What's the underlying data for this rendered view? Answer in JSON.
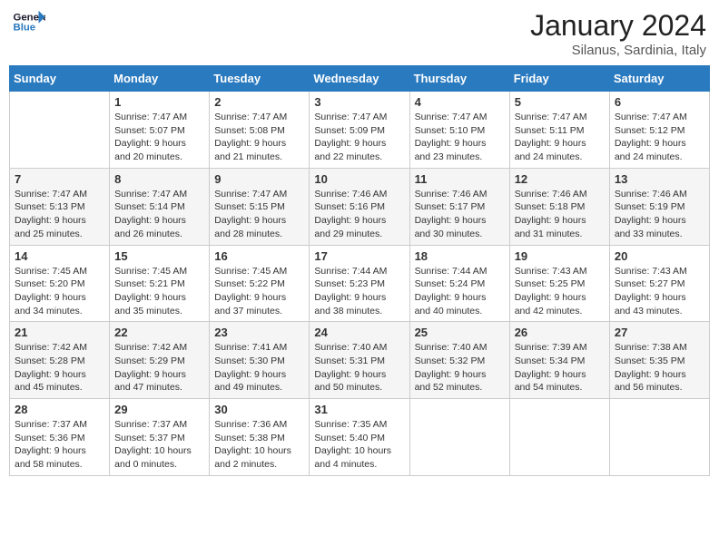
{
  "header": {
    "logo_line1": "General",
    "logo_line2": "Blue",
    "month": "January 2024",
    "location": "Silanus, Sardinia, Italy"
  },
  "weekdays": [
    "Sunday",
    "Monday",
    "Tuesday",
    "Wednesday",
    "Thursday",
    "Friday",
    "Saturday"
  ],
  "weeks": [
    [
      {
        "day": "",
        "sunrise": "",
        "sunset": "",
        "daylight": ""
      },
      {
        "day": "1",
        "sunrise": "Sunrise: 7:47 AM",
        "sunset": "Sunset: 5:07 PM",
        "daylight": "Daylight: 9 hours and 20 minutes."
      },
      {
        "day": "2",
        "sunrise": "Sunrise: 7:47 AM",
        "sunset": "Sunset: 5:08 PM",
        "daylight": "Daylight: 9 hours and 21 minutes."
      },
      {
        "day": "3",
        "sunrise": "Sunrise: 7:47 AM",
        "sunset": "Sunset: 5:09 PM",
        "daylight": "Daylight: 9 hours and 22 minutes."
      },
      {
        "day": "4",
        "sunrise": "Sunrise: 7:47 AM",
        "sunset": "Sunset: 5:10 PM",
        "daylight": "Daylight: 9 hours and 23 minutes."
      },
      {
        "day": "5",
        "sunrise": "Sunrise: 7:47 AM",
        "sunset": "Sunset: 5:11 PM",
        "daylight": "Daylight: 9 hours and 24 minutes."
      },
      {
        "day": "6",
        "sunrise": "Sunrise: 7:47 AM",
        "sunset": "Sunset: 5:12 PM",
        "daylight": "Daylight: 9 hours and 24 minutes."
      }
    ],
    [
      {
        "day": "7",
        "sunrise": "Sunrise: 7:47 AM",
        "sunset": "Sunset: 5:13 PM",
        "daylight": "Daylight: 9 hours and 25 minutes."
      },
      {
        "day": "8",
        "sunrise": "Sunrise: 7:47 AM",
        "sunset": "Sunset: 5:14 PM",
        "daylight": "Daylight: 9 hours and 26 minutes."
      },
      {
        "day": "9",
        "sunrise": "Sunrise: 7:47 AM",
        "sunset": "Sunset: 5:15 PM",
        "daylight": "Daylight: 9 hours and 28 minutes."
      },
      {
        "day": "10",
        "sunrise": "Sunrise: 7:46 AM",
        "sunset": "Sunset: 5:16 PM",
        "daylight": "Daylight: 9 hours and 29 minutes."
      },
      {
        "day": "11",
        "sunrise": "Sunrise: 7:46 AM",
        "sunset": "Sunset: 5:17 PM",
        "daylight": "Daylight: 9 hours and 30 minutes."
      },
      {
        "day": "12",
        "sunrise": "Sunrise: 7:46 AM",
        "sunset": "Sunset: 5:18 PM",
        "daylight": "Daylight: 9 hours and 31 minutes."
      },
      {
        "day": "13",
        "sunrise": "Sunrise: 7:46 AM",
        "sunset": "Sunset: 5:19 PM",
        "daylight": "Daylight: 9 hours and 33 minutes."
      }
    ],
    [
      {
        "day": "14",
        "sunrise": "Sunrise: 7:45 AM",
        "sunset": "Sunset: 5:20 PM",
        "daylight": "Daylight: 9 hours and 34 minutes."
      },
      {
        "day": "15",
        "sunrise": "Sunrise: 7:45 AM",
        "sunset": "Sunset: 5:21 PM",
        "daylight": "Daylight: 9 hours and 35 minutes."
      },
      {
        "day": "16",
        "sunrise": "Sunrise: 7:45 AM",
        "sunset": "Sunset: 5:22 PM",
        "daylight": "Daylight: 9 hours and 37 minutes."
      },
      {
        "day": "17",
        "sunrise": "Sunrise: 7:44 AM",
        "sunset": "Sunset: 5:23 PM",
        "daylight": "Daylight: 9 hours and 38 minutes."
      },
      {
        "day": "18",
        "sunrise": "Sunrise: 7:44 AM",
        "sunset": "Sunset: 5:24 PM",
        "daylight": "Daylight: 9 hours and 40 minutes."
      },
      {
        "day": "19",
        "sunrise": "Sunrise: 7:43 AM",
        "sunset": "Sunset: 5:25 PM",
        "daylight": "Daylight: 9 hours and 42 minutes."
      },
      {
        "day": "20",
        "sunrise": "Sunrise: 7:43 AM",
        "sunset": "Sunset: 5:27 PM",
        "daylight": "Daylight: 9 hours and 43 minutes."
      }
    ],
    [
      {
        "day": "21",
        "sunrise": "Sunrise: 7:42 AM",
        "sunset": "Sunset: 5:28 PM",
        "daylight": "Daylight: 9 hours and 45 minutes."
      },
      {
        "day": "22",
        "sunrise": "Sunrise: 7:42 AM",
        "sunset": "Sunset: 5:29 PM",
        "daylight": "Daylight: 9 hours and 47 minutes."
      },
      {
        "day": "23",
        "sunrise": "Sunrise: 7:41 AM",
        "sunset": "Sunset: 5:30 PM",
        "daylight": "Daylight: 9 hours and 49 minutes."
      },
      {
        "day": "24",
        "sunrise": "Sunrise: 7:40 AM",
        "sunset": "Sunset: 5:31 PM",
        "daylight": "Daylight: 9 hours and 50 minutes."
      },
      {
        "day": "25",
        "sunrise": "Sunrise: 7:40 AM",
        "sunset": "Sunset: 5:32 PM",
        "daylight": "Daylight: 9 hours and 52 minutes."
      },
      {
        "day": "26",
        "sunrise": "Sunrise: 7:39 AM",
        "sunset": "Sunset: 5:34 PM",
        "daylight": "Daylight: 9 hours and 54 minutes."
      },
      {
        "day": "27",
        "sunrise": "Sunrise: 7:38 AM",
        "sunset": "Sunset: 5:35 PM",
        "daylight": "Daylight: 9 hours and 56 minutes."
      }
    ],
    [
      {
        "day": "28",
        "sunrise": "Sunrise: 7:37 AM",
        "sunset": "Sunset: 5:36 PM",
        "daylight": "Daylight: 9 hours and 58 minutes."
      },
      {
        "day": "29",
        "sunrise": "Sunrise: 7:37 AM",
        "sunset": "Sunset: 5:37 PM",
        "daylight": "Daylight: 10 hours and 0 minutes."
      },
      {
        "day": "30",
        "sunrise": "Sunrise: 7:36 AM",
        "sunset": "Sunset: 5:38 PM",
        "daylight": "Daylight: 10 hours and 2 minutes."
      },
      {
        "day": "31",
        "sunrise": "Sunrise: 7:35 AM",
        "sunset": "Sunset: 5:40 PM",
        "daylight": "Daylight: 10 hours and 4 minutes."
      },
      {
        "day": "",
        "sunrise": "",
        "sunset": "",
        "daylight": ""
      },
      {
        "day": "",
        "sunrise": "",
        "sunset": "",
        "daylight": ""
      },
      {
        "day": "",
        "sunrise": "",
        "sunset": "",
        "daylight": ""
      }
    ]
  ]
}
